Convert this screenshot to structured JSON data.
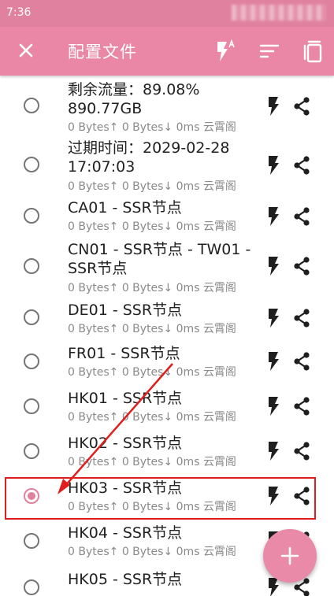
{
  "status_bar": {
    "time": "7:36"
  },
  "toolbar": {
    "title": "配置文件",
    "close_icon": "close-icon",
    "actions": [
      "flash-auto-icon",
      "sort-icon",
      "copy-icon"
    ]
  },
  "colors": {
    "primary": "#ea87a6",
    "status_bar": "#e0829f",
    "annotation": "#e01e1e"
  },
  "profiles": [
    {
      "name": "剩余流量：89.08% 890.77GB",
      "stats": "0 Bytes↑ 0 Bytes↓ 0ms 云霄阁",
      "selected": false
    },
    {
      "name": "过期时间：2029-02-28 17:07:03",
      "stats": "0 Bytes↑ 0 Bytes↓ 0ms 云霄阁",
      "selected": false
    },
    {
      "name": "CA01 - SSR节点",
      "stats": "0 Bytes↑ 0 Bytes↓ 0ms 云霄阁",
      "selected": false
    },
    {
      "name": "CN01 - SSR节点 - TW01 - SSR节点",
      "stats": "0 Bytes↑ 0 Bytes↓ 0ms 云霄阁",
      "selected": false
    },
    {
      "name": "DE01 - SSR节点",
      "stats": "0 Bytes↑ 0 Bytes↓ 0ms 云霄阁",
      "selected": false
    },
    {
      "name": "FR01 - SSR节点",
      "stats": "0 Bytes↑ 0 Bytes↓ 0ms 云霄阁",
      "selected": false
    },
    {
      "name": "HK01 - SSR节点",
      "stats": "0 Bytes↑ 0 Bytes↓ 0ms 云霄阁",
      "selected": false
    },
    {
      "name": "HK02 - SSR节点",
      "stats": "0 Bytes↑ 0 Bytes↓ 0ms 云霄阁",
      "selected": false
    },
    {
      "name": "HK03 - SSR节点",
      "stats": "0 Bytes↑ 0 Bytes↓ 0ms 云霄阁",
      "selected": true
    },
    {
      "name": "HK04 - SSR节点",
      "stats": "0 Bytes↑ 0 Bytes↓ 0ms 云霄阁",
      "selected": false
    },
    {
      "name": "HK05 - SSR节点",
      "stats": "",
      "selected": false
    }
  ],
  "row_icons": {
    "flash": "flash-icon",
    "share": "share-icon"
  },
  "fab": {
    "icon": "add-icon"
  }
}
